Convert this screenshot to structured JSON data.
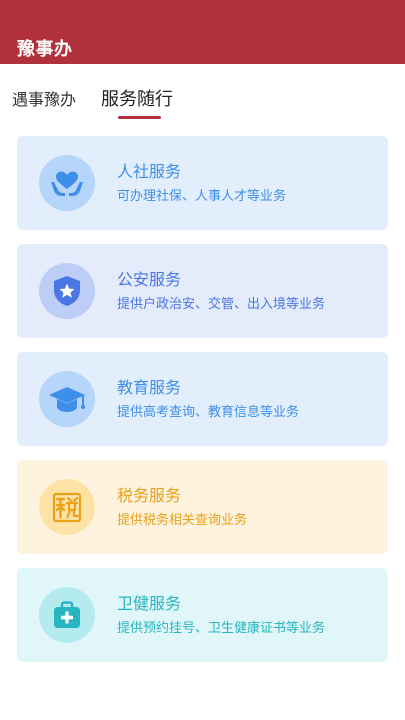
{
  "header": {
    "title": "豫事办"
  },
  "tabs": [
    {
      "label": "遇事豫办",
      "active": false
    },
    {
      "label": "服务随行",
      "active": true
    }
  ],
  "colors": {
    "header_bg": "#b0303b",
    "blue": "#3d8fe8",
    "indigo": "#4a77e3",
    "orange": "#eaa21a",
    "teal": "#28b5c0"
  },
  "services": [
    {
      "title": "人社服务",
      "desc": "可办理社保、人事人才等业务",
      "icon": "hand-heart-icon"
    },
    {
      "title": "公安服务",
      "desc": "提供户政治安、交管、出入境等业务",
      "icon": "police-shield-icon"
    },
    {
      "title": "教育服务",
      "desc": "提供高考查询、教育信息等业务",
      "icon": "graduation-cap-icon"
    },
    {
      "title": "税务服务",
      "desc": "提供税务相关查询业务",
      "icon": "tax-seal-icon"
    },
    {
      "title": "卫健服务",
      "desc": "提供预约挂号、卫生健康证书等业务",
      "icon": "medical-kit-icon"
    }
  ]
}
